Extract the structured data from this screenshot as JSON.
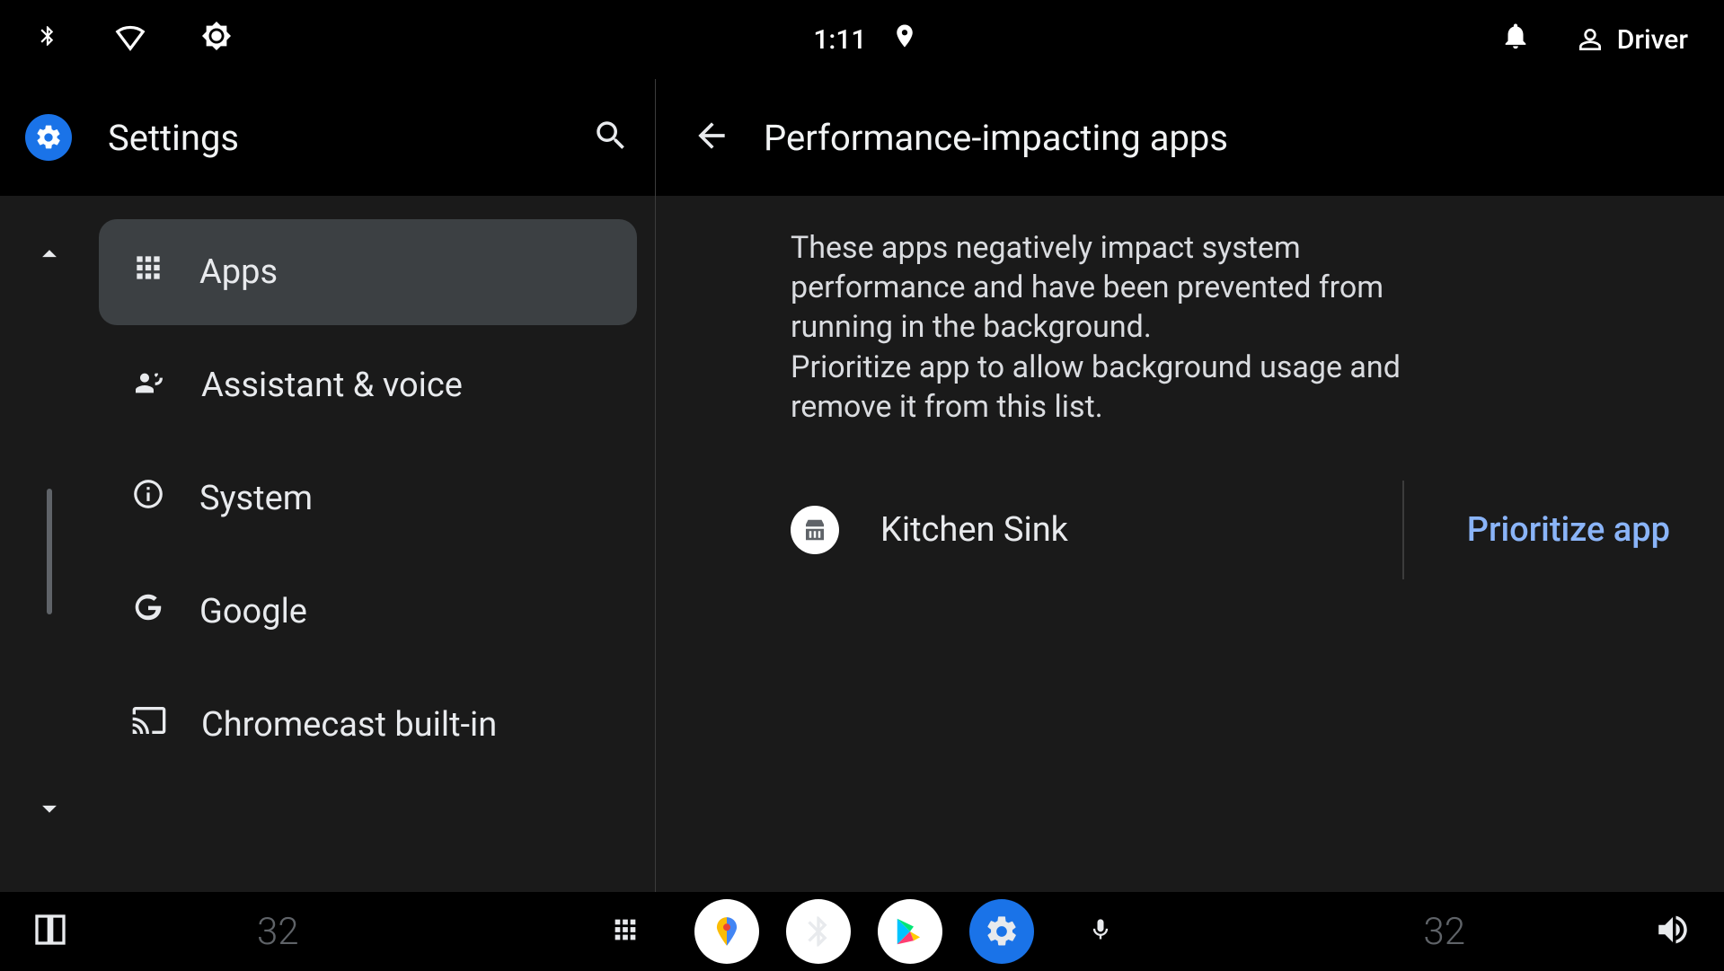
{
  "statusbar": {
    "time": "1:11",
    "user": "Driver"
  },
  "left": {
    "title": "Settings",
    "items": [
      {
        "label": "Apps",
        "selected": true
      },
      {
        "label": "Assistant & voice"
      },
      {
        "label": "System"
      },
      {
        "label": "Google"
      },
      {
        "label": "Chromecast built-in"
      }
    ]
  },
  "right": {
    "title": "Performance-impacting apps",
    "description1": "These apps negatively impact system performance and have been prevented from running in the background.",
    "description2": "Prioritize app to allow background usage and remove it from this list.",
    "apps": [
      {
        "name": "Kitchen Sink",
        "action": "Prioritize app"
      }
    ]
  },
  "navbar": {
    "temp_left": "32",
    "temp_right": "32"
  },
  "colors": {
    "accent": "#8ab4f8",
    "primary": "#1a73e8"
  }
}
